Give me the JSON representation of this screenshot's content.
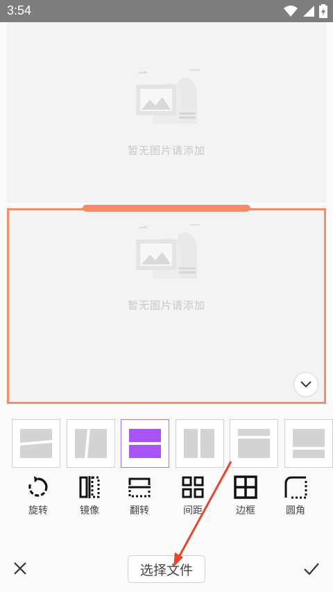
{
  "status_bar": {
    "time": "3:54",
    "icons": [
      "wifi-icon",
      "cellular-icon",
      "battery-icon"
    ]
  },
  "editor": {
    "panels": [
      {
        "placeholder_text": "暂无图片请添加",
        "selected": false
      },
      {
        "placeholder_text": "暂无图片请添加",
        "selected": true
      }
    ],
    "accent_color": "#f58b6a",
    "expand_icon": "chevron-down-icon"
  },
  "layouts": {
    "selected_index": 2,
    "selected_color": "#a855f7",
    "items": [
      "layout-diagonal-horizontal",
      "layout-diagonal-vertical",
      "layout-two-rows",
      "layout-two-columns",
      "layout-top-bottom-split",
      "layout-wide-bottom"
    ]
  },
  "tools": [
    {
      "label": "旋转",
      "icon": "rotate-icon"
    },
    {
      "label": "镜像",
      "icon": "mirror-icon"
    },
    {
      "label": "翻转",
      "icon": "flip-icon"
    },
    {
      "label": "间距",
      "icon": "spacing-icon"
    },
    {
      "label": "边框",
      "icon": "border-icon"
    },
    {
      "label": "圆角",
      "icon": "rounded-corner-icon"
    }
  ],
  "bottom_bar": {
    "select_file_label": "选择文件",
    "close_icon": "close-icon",
    "confirm_icon": "check-icon"
  },
  "annotation": {
    "arrow_color": "#e8442a"
  }
}
